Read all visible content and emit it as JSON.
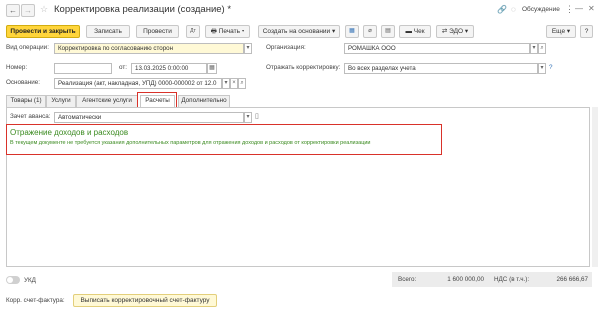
{
  "window": {
    "title": "Корректировка реализации (создание) *",
    "discussion": "Обсуждение",
    "more_icon": "⋮",
    "minimize_icon": "—",
    "close_icon": "✕"
  },
  "toolbar": {
    "post_close": "Провести и закрыть",
    "save": "Записать",
    "post": "Провести",
    "print": "Печать",
    "create_based_on": "Создать на основании",
    "check": "Чек",
    "edo": "ЭДО",
    "more": "Еще",
    "help": "?"
  },
  "form": {
    "operation_label": "Вид операции:",
    "operation_value": "Корректировка по согласованию сторон",
    "organization_label": "Организация:",
    "organization_value": "РОМАШКА ООО",
    "number_label": "Номер:",
    "number_value": "",
    "from_label": "от:",
    "date_value": "13.03.2025  0:00:00",
    "reflect_label": "Отражать корректировку:",
    "reflect_value": "Во всех разделах учета",
    "reflect_help": "?",
    "basis_label": "Основание:",
    "basis_value": "Реализация (акт, накладная, УПД) 0000-000002 от 12.0"
  },
  "tabs": [
    {
      "label": "Товары (1)"
    },
    {
      "label": "Услуги"
    },
    {
      "label": "Агентские услуги"
    },
    {
      "label": "Расчеты"
    },
    {
      "label": "Дополнительно"
    }
  ],
  "settlements": {
    "advance_label": "Зачет аванса:",
    "advance_value": "Автоматически",
    "section_title": "Отражение доходов и расходов",
    "section_text": "В текущем документе не требуется указания дополнительных параметров для отражения доходов и расходов от корректировки реализации"
  },
  "footer": {
    "ukd_label": "УКД",
    "total_label": "Всего:",
    "total_value": "1 600 000,00",
    "vat_label": "НДС (в т.ч.):",
    "vat_value": "266 666,67",
    "invoice_label": "Корр. счет-фактура:",
    "invoice_button": "Выписать корректировочный счет-фактуру"
  },
  "colors": {
    "accent_yellow": "#ffd53b",
    "green_text": "#3a8a1f",
    "highlight_red": "#d9322a"
  }
}
